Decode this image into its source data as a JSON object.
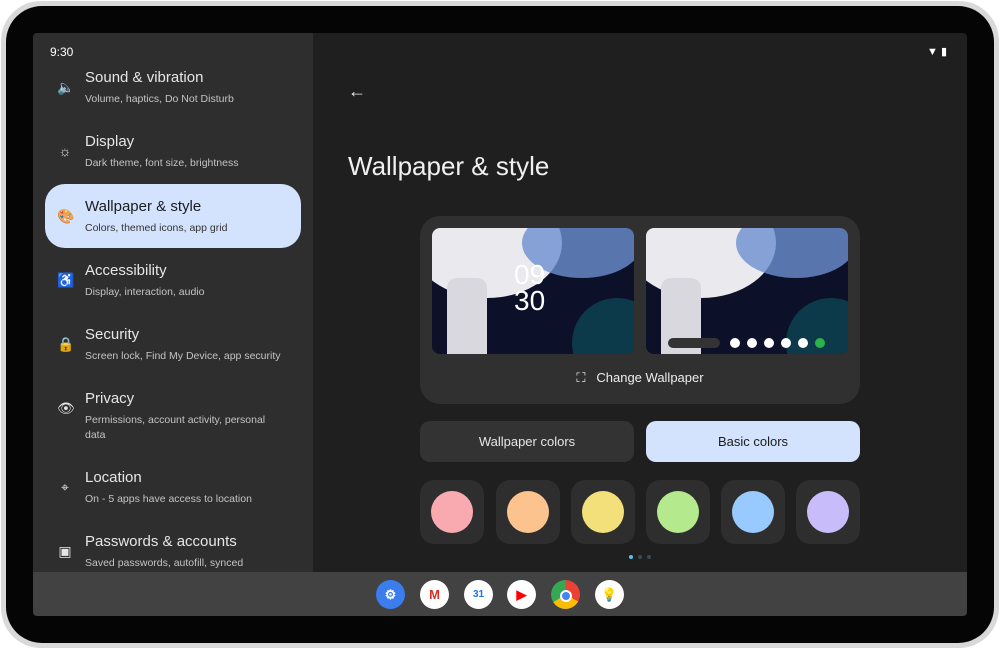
{
  "status": {
    "time": "9:30"
  },
  "sidebar": {
    "items": [
      {
        "title": "Sound & vibration",
        "subtitle": "Volume, haptics, Do Not Disturb",
        "icon": "speaker-icon"
      },
      {
        "title": "Display",
        "subtitle": "Dark theme, font size, brightness",
        "icon": "brightness-icon"
      },
      {
        "title": "Wallpaper & style",
        "subtitle": "Colors, themed icons, app grid",
        "icon": "palette-icon",
        "selected": true
      },
      {
        "title": "Accessibility",
        "subtitle": "Display, interaction, audio",
        "icon": "accessibility-icon"
      },
      {
        "title": "Security",
        "subtitle": "Screen lock, Find My Device, app security",
        "icon": "lock-icon"
      },
      {
        "title": "Privacy",
        "subtitle": "Permissions, account activity, personal data",
        "icon": "eye-icon"
      },
      {
        "title": "Location",
        "subtitle": "On - 5 apps have access to location",
        "icon": "location-pin-icon"
      },
      {
        "title": "Passwords & accounts",
        "subtitle": "Saved passwords, autofill, synced",
        "icon": "account-box-icon"
      }
    ]
  },
  "main": {
    "title": "Wallpaper & style",
    "lock_clock": "09\n30",
    "change_wallpaper": "Change Wallpaper",
    "tabs": [
      {
        "label": "Wallpaper colors",
        "selected": false
      },
      {
        "label": "Basic colors",
        "selected": true
      }
    ],
    "swatches": [
      "#f8aab0",
      "#fcc38f",
      "#f4e07a",
      "#b5e98e",
      "#98c9ff",
      "#c9bcfb"
    ],
    "page_indicator": {
      "pages": 3,
      "current": 1
    }
  },
  "taskbar": {
    "apps": [
      "Settings",
      "Gmail",
      "Calendar",
      "YouTube",
      "Chrome",
      "Keep"
    ],
    "calendar_day": "31"
  },
  "colors": {
    "accent": "#d3e3fd",
    "sidebar": "#2e2e2e",
    "background": "#1f1f1f"
  }
}
